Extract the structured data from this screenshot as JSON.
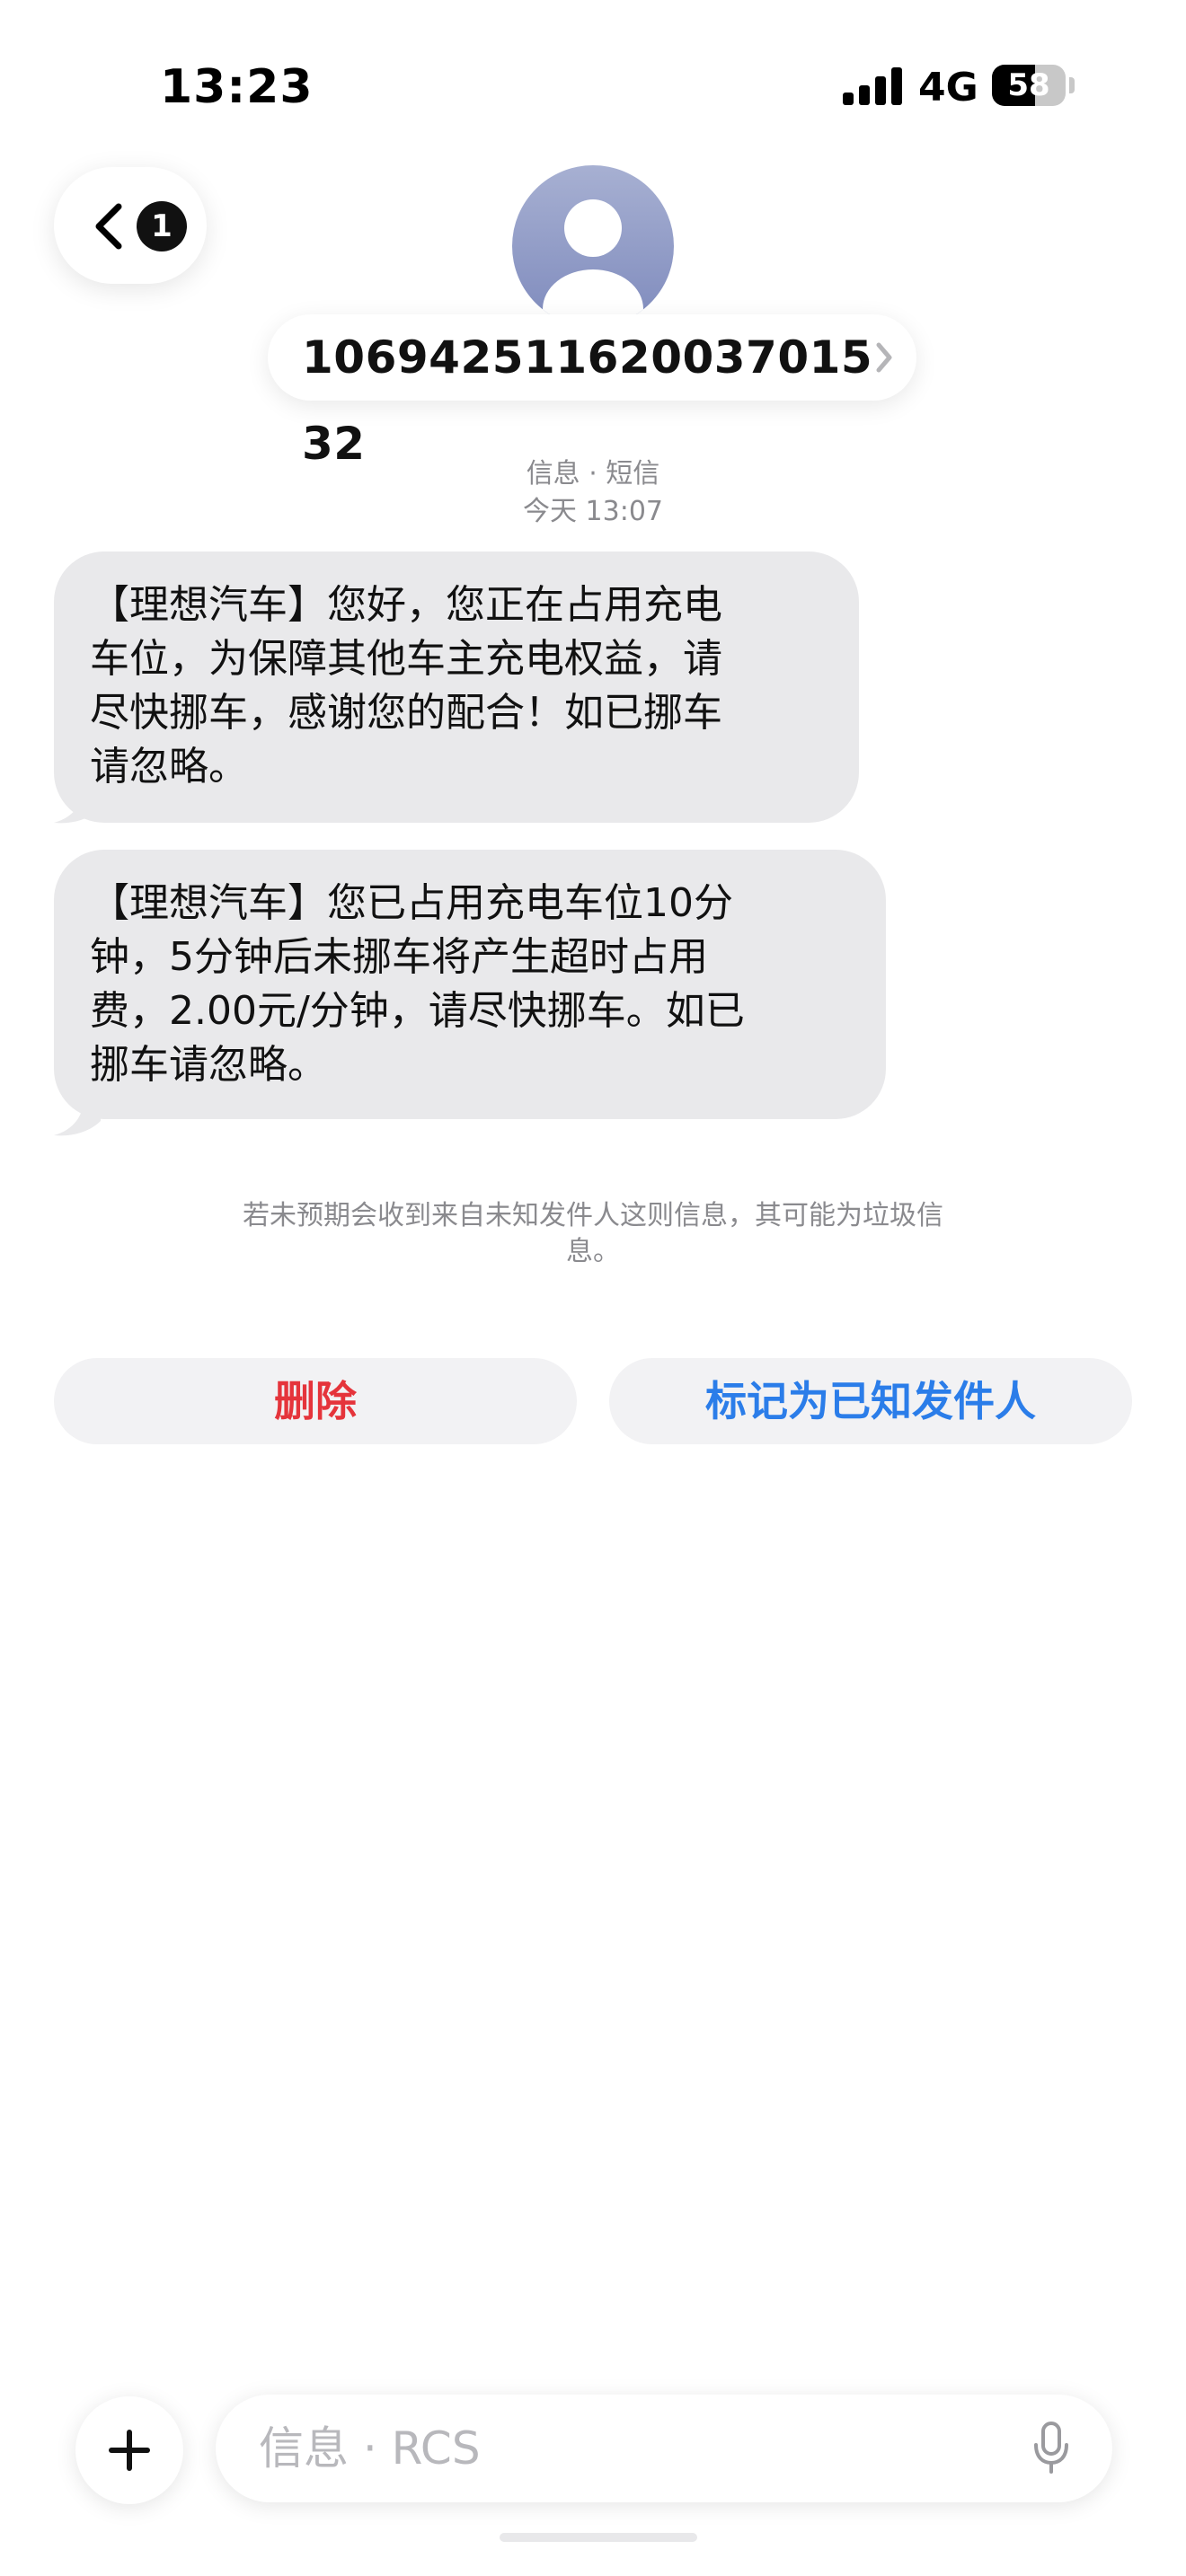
{
  "status_bar": {
    "time": "13:23",
    "network": "4G",
    "battery_percent": "58",
    "battery_level": 0.58
  },
  "header": {
    "back_badge_count": "1",
    "contact_number": "106942511620037015 32"
  },
  "thread": {
    "service_label": "信息 · 短信",
    "timestamp": "今天 13:07",
    "messages": [
      {
        "lines": [
          "【理想汽车】您好，您正在占用充电",
          "车位，为保障其他车主充电权益，请",
          "尽快挪车，感谢您的配合！如已挪车",
          "请忽略。"
        ]
      },
      {
        "lines": [
          "【理想汽车】您已占用充电车位10分",
          "钟，5分钟后未挪车将产生超时占用",
          "费，2.00元/分钟，请尽快挪车。如已",
          "挪车请忽略。"
        ]
      }
    ],
    "spam_notice_lines": [
      "若未预期会收到来自未知发件人这则信息，其可能为垃圾信",
      "息。"
    ]
  },
  "actions": {
    "delete_label": "删除",
    "mark_known_label": "标记为已知发件人"
  },
  "composer": {
    "placeholder": "信息 · RCS"
  },
  "colors": {
    "bubble": "#e9e9eb",
    "delete_text": "#e5343b",
    "mark_known_text": "#2b7de9",
    "meta_text": "#8a8a8e"
  },
  "icons": {
    "back": "chevron-left-icon",
    "avatar": "person-silhouette-icon",
    "contact_disclosure": "chevron-right-icon",
    "plus": "plus-icon",
    "mic": "microphone-icon"
  }
}
